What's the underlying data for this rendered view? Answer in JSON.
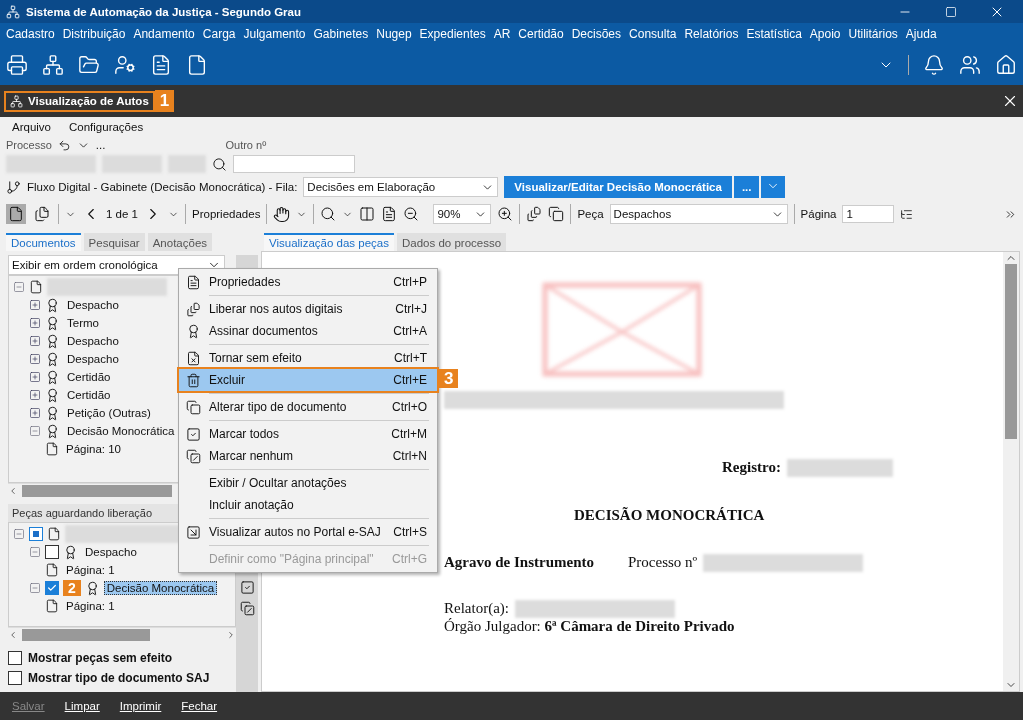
{
  "window": {
    "title": "Sistema de Automação da Justiça - Segundo Grau"
  },
  "menu_bar": [
    "Cadastro",
    "Distribuição",
    "Andamento",
    "Carga",
    "Julgamento",
    "Gabinetes",
    "Nugep",
    "Expedientes",
    "AR",
    "Certidão",
    "Decisões",
    "Consulta",
    "Relatórios",
    "Estatística",
    "Apoio",
    "Utilitários",
    "Ajuda"
  ],
  "doc_tab": {
    "title": "Visualização de Autos",
    "badge": "1"
  },
  "sub_menu": [
    "Arquivo",
    "Configurações"
  ],
  "processo": {
    "label": "Processo",
    "more": "...",
    "other_label": "Outro nº"
  },
  "fluxo": {
    "text": "Fluxo Digital - Gabinete (Decisão Monocrática) - Fila:",
    "queue": "Decisões em Elaboração",
    "primary_button": "Visualizar/Editar Decisão Monocrática",
    "more_button": "..."
  },
  "viewer_toolbar": {
    "page_count": "1 de 1",
    "properties": "Propriedades",
    "zoom": "90%",
    "peca_label": "Peça",
    "peca": "Despachos",
    "pagina_label": "Página",
    "pagina": "1"
  },
  "left_tabs": [
    {
      "label": "Documentos",
      "selected": true
    },
    {
      "label": "Pesquisar",
      "selected": false
    },
    {
      "label": "Anotações",
      "selected": false
    }
  ],
  "right_tabs": [
    {
      "label": "Visualização das peças",
      "selected": true
    },
    {
      "label": "Dados do processo",
      "selected": false
    }
  ],
  "order_select": "Exibir em ordem cronológica",
  "documents_tree": [
    {
      "kind": "root",
      "expanded": true,
      "children": [
        {
          "kind": "doc",
          "label": "Despacho",
          "expanded": false
        },
        {
          "kind": "doc",
          "label": "Termo",
          "expanded": false
        },
        {
          "kind": "doc",
          "label": "Despacho",
          "expanded": false
        },
        {
          "kind": "doc",
          "label": "Despacho",
          "expanded": false
        },
        {
          "kind": "doc",
          "label": "Certidão",
          "expanded": false
        },
        {
          "kind": "doc",
          "label": "Certidão",
          "expanded": false
        },
        {
          "kind": "doc",
          "label": "Petição (Outras)",
          "expanded": false
        },
        {
          "kind": "doc",
          "label": "Decisão Monocrática",
          "expanded": true,
          "children": [
            {
              "kind": "page",
              "label": "Página: 10"
            }
          ]
        }
      ]
    }
  ],
  "pending": {
    "title": "Peças aguardando liberação",
    "tree": [
      {
        "kind": "root",
        "expanded": true,
        "checked": true,
        "partial": true,
        "children": [
          {
            "kind": "doc",
            "label": "Despacho",
            "expanded": true,
            "checked": false,
            "selected": false,
            "children": [
              {
                "kind": "page",
                "label": "Página: 1"
              }
            ]
          },
          {
            "kind": "doc",
            "label": "Decisão Monocrática",
            "expanded": true,
            "checked": true,
            "selected": true,
            "badge": "2",
            "children": [
              {
                "kind": "page",
                "label": "Página: 1"
              }
            ]
          }
        ]
      }
    ]
  },
  "options": [
    {
      "label": "Mostrar peças sem efeito",
      "checked": false
    },
    {
      "label": "Mostrar tipo de documento SAJ",
      "checked": false
    }
  ],
  "context_menu": [
    {
      "kind": "item",
      "label": "Propriedades",
      "shortcut": "Ctrl+P",
      "selected": false,
      "disabled": false
    },
    {
      "kind": "separator"
    },
    {
      "kind": "item",
      "label": "Liberar nos autos digitais",
      "shortcut": "Ctrl+J",
      "selected": false,
      "disabled": false
    },
    {
      "kind": "item",
      "label": "Assinar documentos",
      "shortcut": "Ctrl+A",
      "selected": false,
      "disabled": false
    },
    {
      "kind": "separator"
    },
    {
      "kind": "item",
      "label": "Tornar sem efeito",
      "shortcut": "Ctrl+T",
      "selected": false,
      "disabled": false
    },
    {
      "kind": "item",
      "label": "Excluir",
      "shortcut": "Ctrl+E",
      "selected": true,
      "disabled": false,
      "badge": "3"
    },
    {
      "kind": "separator"
    },
    {
      "kind": "item",
      "label": "Alterar tipo de documento",
      "shortcut": "Ctrl+O",
      "selected": false,
      "disabled": false
    },
    {
      "kind": "separator"
    },
    {
      "kind": "item",
      "label": "Marcar todos",
      "shortcut": "Ctrl+M",
      "selected": false,
      "disabled": false
    },
    {
      "kind": "item",
      "label": "Marcar nenhum",
      "shortcut": "Ctrl+N",
      "selected": false,
      "disabled": false
    },
    {
      "kind": "separator"
    },
    {
      "kind": "item",
      "label": "Exibir / Ocultar anotações",
      "selected": false,
      "disabled": false
    },
    {
      "kind": "item",
      "label": "Incluir anotação",
      "selected": false,
      "disabled": false
    },
    {
      "kind": "separator"
    },
    {
      "kind": "item",
      "label": "Visualizar autos no Portal e-SAJ",
      "shortcut": "Ctrl+S",
      "selected": false,
      "disabled": false
    },
    {
      "kind": "separator"
    },
    {
      "kind": "item",
      "label": "Definir como \"Página principal\"",
      "shortcut": "Ctrl+G",
      "selected": false,
      "disabled": true
    }
  ],
  "document": {
    "registro_label": "Registro:",
    "title": "DECISÃO MONOCRÁTICA",
    "case_type": "Agravo de Instrumento",
    "processo_label": "Processo nº",
    "relator_label": "Relator(a):",
    "orgao": "Órgão Julgador: **6ª Câmara de Direito Privado**"
  },
  "footer": [
    {
      "label": "Salvar",
      "disabled": true
    },
    {
      "label": "Limpar",
      "disabled": false
    },
    {
      "label": "Imprimir",
      "disabled": false
    },
    {
      "label": "Fechar",
      "disabled": false
    }
  ]
}
